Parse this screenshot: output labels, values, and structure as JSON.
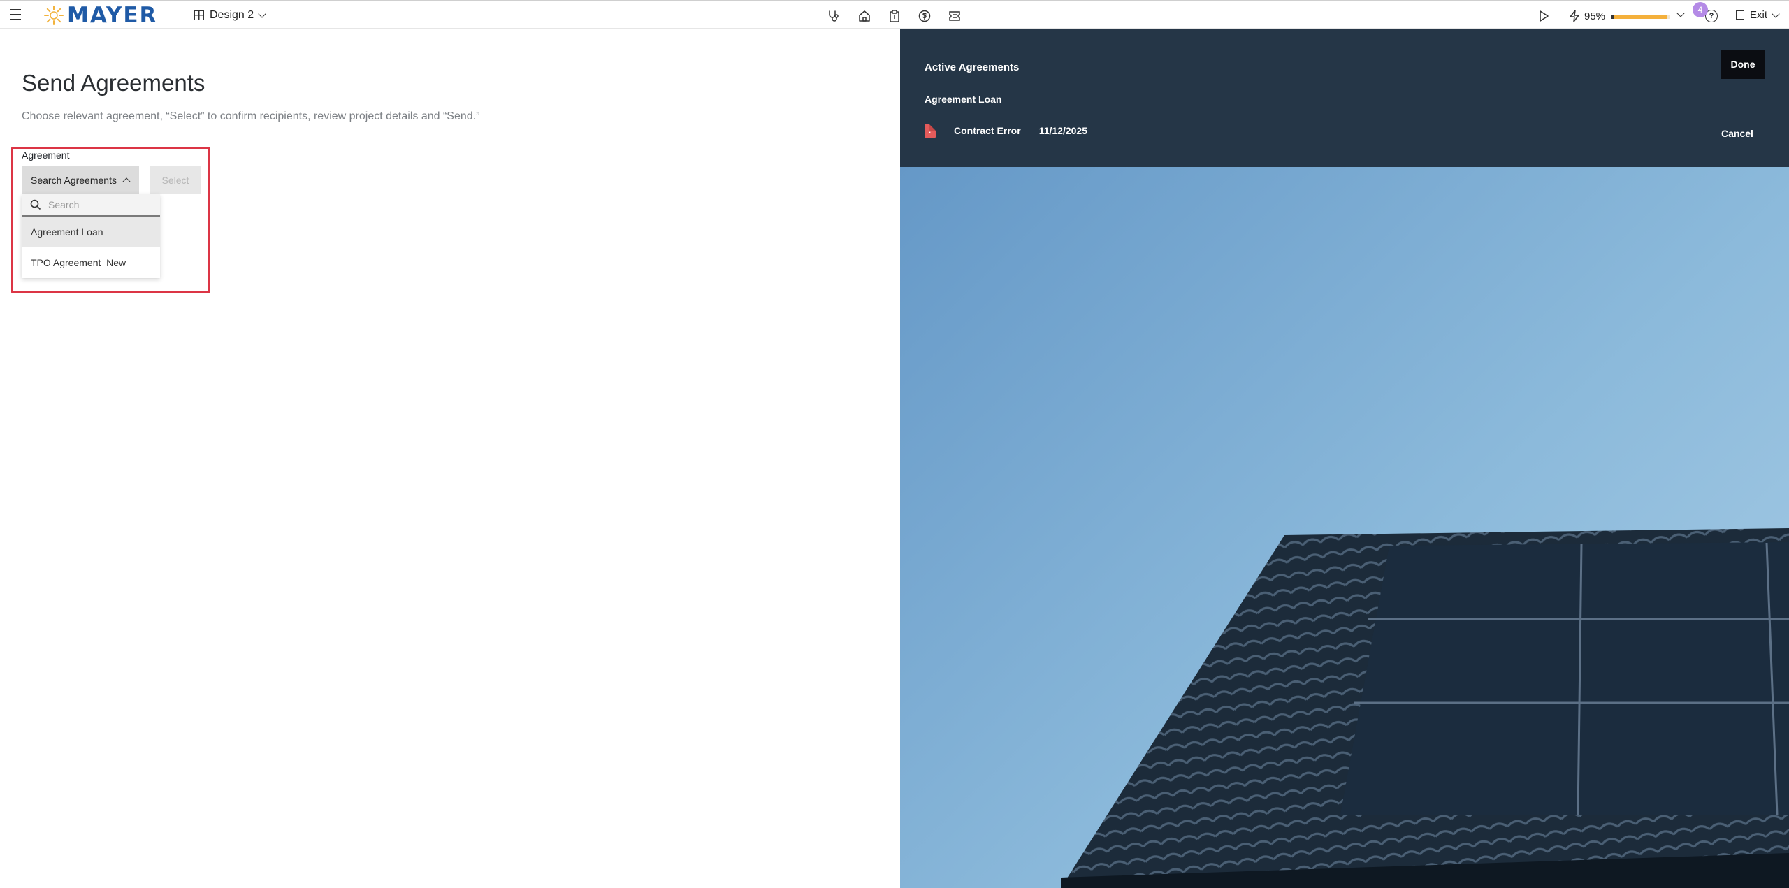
{
  "header": {
    "brand": "MAYER",
    "design_label": "Design 2",
    "percent": "95%",
    "progress_fraction": 0.95,
    "notification_count": "4",
    "help_glyph": "?",
    "exit_label": "Exit",
    "icons": [
      "hamburger-menu-icon",
      "sun-logo-icon",
      "grid-icon",
      "chevron-down-icon",
      "stethoscope-icon",
      "home-icon",
      "clipboard-icon",
      "dollar-icon",
      "ticket-icon",
      "play-icon",
      "bolt-icon",
      "help-icon",
      "exit-door-icon"
    ]
  },
  "main": {
    "title": "Send Agreements",
    "subtitle": "Choose relevant agreement, “Select” to confirm recipients, review project details and “Send.”",
    "agreement_label": "Agreement",
    "search_button_label": "Search Agreements",
    "select_button_label": "Select",
    "dropdown": {
      "search_placeholder": "Search",
      "items": [
        "Agreement Loan",
        "TPO Agreement_New"
      ]
    }
  },
  "panel": {
    "title": "Active Agreements",
    "subtitle": "Agreement Loan",
    "row": {
      "status": "Contract Error",
      "date": "11/12/2025",
      "icon": "contract-error-doc-icon"
    },
    "done_label": "Done",
    "cancel_label": "Cancel"
  },
  "colors": {
    "brand_blue": "#1f5aa6",
    "highlight_red": "#dc3545",
    "panel_navy": "#253647",
    "progress_orange": "#f4b03b",
    "badge_purple": "#b48ae6"
  }
}
